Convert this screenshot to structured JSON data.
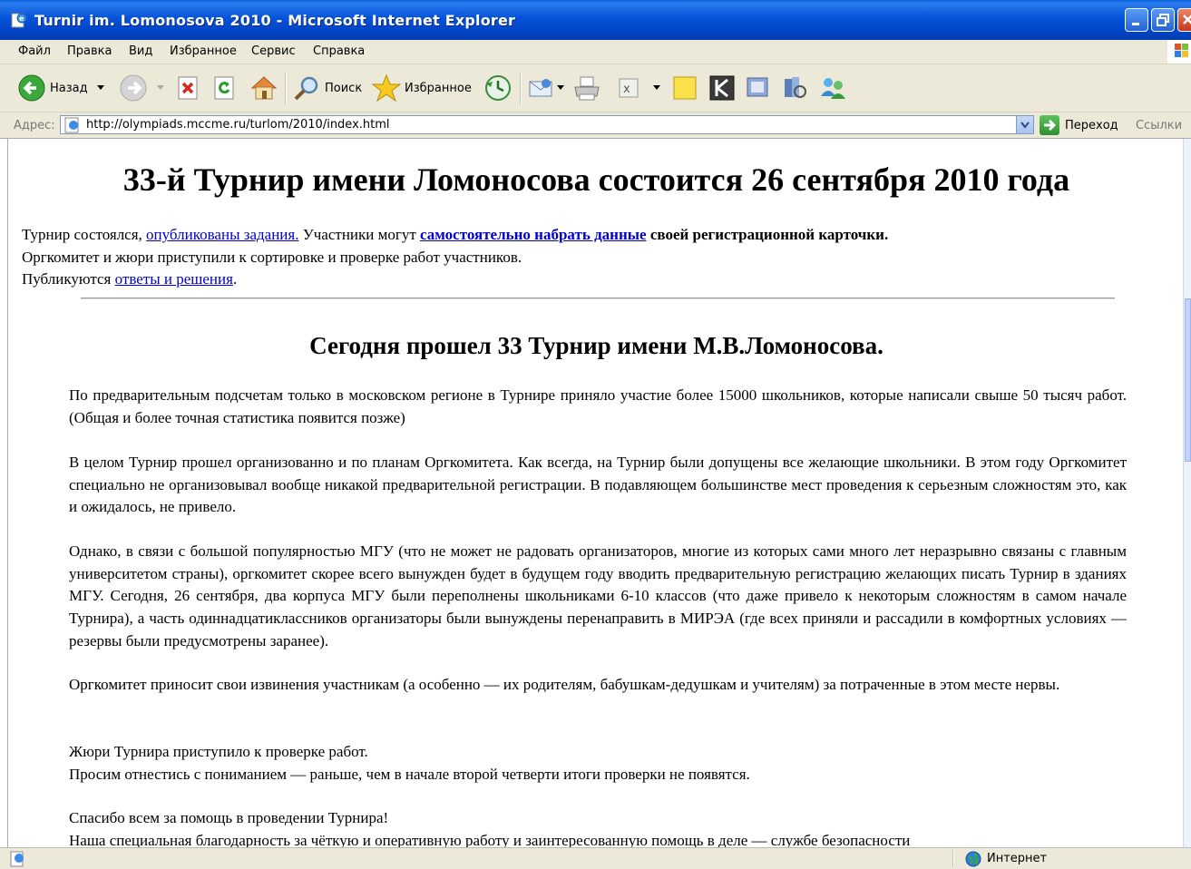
{
  "window": {
    "title": "Turnir im. Lomonosova 2010 - Microsoft Internet Explorer"
  },
  "menu": {
    "items": [
      "Файл",
      "Правка",
      "Вид",
      "Избранное",
      "Сервис",
      "Справка"
    ]
  },
  "toolbar": {
    "back_label": "Назад",
    "search_label": "Поиск",
    "favorites_label": "Избранное"
  },
  "address": {
    "label": "Адрес:",
    "url": "http://olympiads.mccme.ru/turlom/2010/index.html",
    "go_label": "Переход",
    "links_label": "Ссылки"
  },
  "page": {
    "heading": "33-й Турнир имени Ломоносова состоится 26 сентября 2010 года",
    "intro": {
      "l1_pre": "Турнир состоялся, ",
      "l1_link1": "опубликованы задания.",
      "l1_mid": " Участники могут ",
      "l1_link2": "самостоятельно набрать данные",
      "l1_bold": " своей регистрационной карточки.",
      "l2": "Оргкомитет и жюри приступили к сортировке и проверке работ участников.",
      "l3_pre": "Публикуются ",
      "l3_link": "ответы и решения",
      "l3_post": "."
    },
    "subheading": "Сегодня прошел 33 Турнир имени М.В.Ломоносова.",
    "p1": "По предварительным подсчетам только в московском регионе в Турнире приняло участие более 15000 школьников, которые написали свыше 50 тысяч работ. (Общая и более точная статистика появится позже)",
    "p2": "В целом Турнир прошел организованно и по планам Оргкомитета. Как всегда, на Турнир были допущены все желающие школьники. В этом году Оргкомитет специально не организовывал вообще никакой предварительной регистрации. В подавляющем большинстве мест проведения к серьезным сложностям это, как и ожидалось, не привело.",
    "p3": "Однако, в связи с большой популярностью МГУ (что не может не радовать организаторов, многие из которых сами много лет неразрывно связаны с главным университетом страны), оргкомитет скорее всего вынужден будет в будущем году вводить предварительную регистрацию желающих писать Турнир в зданиях МГУ. Сегодня, 26 сентября, два корпуса МГУ были переполнены школьниками 6-10 классов (что даже привело к некоторым сложностям в самом начале Турнира), а часть одиннадцатиклассников организаторы были вынуждены перенаправить в МИРЭА (где всех приняли и рассадили в комфортных условиях — резервы были предусмотрены заранее).",
    "p4": "Оргкомитет приносит свои извинения участникам (а особенно — их родителям, бабушкам-дедушкам и учителям) за потраченные в этом месте нервы.",
    "p5a": "Жюри Турнира приступило к проверке работ.",
    "p5b": "Просим отнестись с пониманием — раньше, чем в начале второй четверти итоги проверки не появятся.",
    "p6a": "Спасибо всем за помощь в проведении Турнира!",
    "p6b": "Наша специальная благодарность за чёткую и оперативную работу и заинтересованную помощь в деле — службе безопасности"
  },
  "status": {
    "zone_label": "Интернет"
  }
}
